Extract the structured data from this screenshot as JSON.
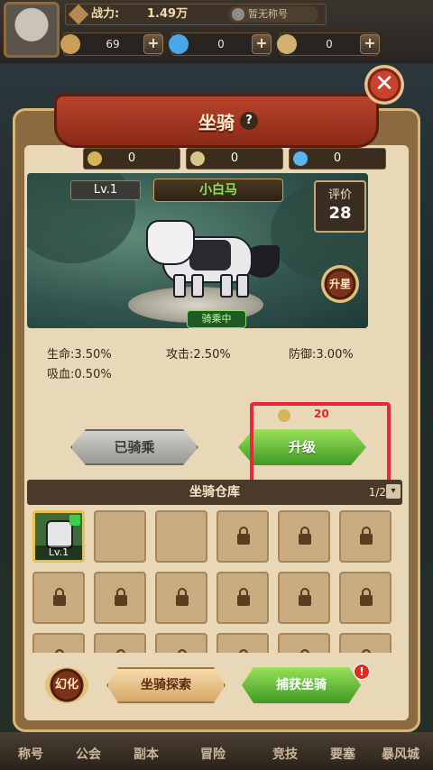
{
  "topbar": {
    "power_label": "战力:",
    "power_value": "1.49万",
    "guild_tag": "暂无称号",
    "resources": [
      {
        "icon": "coin-icon",
        "value": "69",
        "color": "#c9a05a"
      },
      {
        "icon": "diamond-icon",
        "value": "0",
        "color": "#4aa6e8"
      },
      {
        "icon": "scroll-icon",
        "value": "0",
        "color": "#d4b070"
      }
    ]
  },
  "panel": {
    "title": "坐骑",
    "help": "?",
    "costs": [
      {
        "icon": "wheat-icon",
        "value": "0",
        "color": "#d4b458"
      },
      {
        "icon": "butterfly-icon",
        "value": "0",
        "color": "#d8c48a"
      },
      {
        "icon": "gem-icon",
        "value": "0",
        "color": "#5ab6f0"
      }
    ],
    "level": "Lv.1",
    "mount_name": "小白马",
    "rating_label": "评价",
    "rating_value": "28",
    "star_up": "升星",
    "riding_status": "骑乘中",
    "close": "✕"
  },
  "stats": [
    {
      "label": "生命:",
      "value": "3.50%"
    },
    {
      "label": "攻击:",
      "value": "2.50%"
    },
    {
      "label": "防御:",
      "value": "3.00%"
    },
    {
      "label": "吸血:",
      "value": "0.50%"
    }
  ],
  "actions": {
    "ridden": "已骑乘",
    "upgrade": "升级",
    "upgrade_cost": "20",
    "upgrade_cost_color": "#e02a20"
  },
  "warehouse": {
    "title": "坐骑仓库",
    "page": "1/2",
    "filter": "▾",
    "mount_level": "Lv.1"
  },
  "bottom_actions": {
    "transform": "幻化",
    "explore": "坐骑探索",
    "capture": "捕获坐骑",
    "alert": "!"
  },
  "nav": [
    "称号",
    "公会",
    "副本",
    "冒险",
    "竞技",
    "要塞",
    "暴风城"
  ]
}
